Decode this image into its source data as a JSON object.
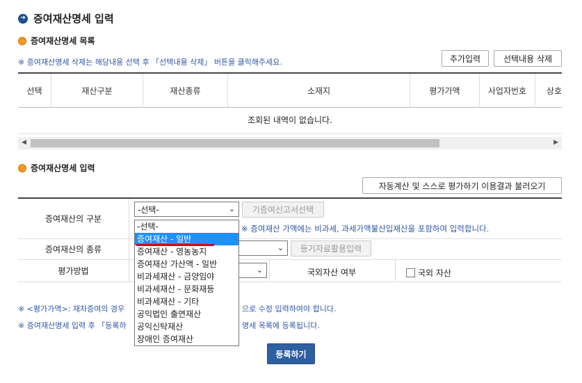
{
  "page": {
    "title": "증여재산명세 입력"
  },
  "list_section": {
    "title": "증여재산명세 목록",
    "notice": "※ 증여재산명세 삭제는 해당내용 선택 후 「선택내용 삭제」 버튼을 클릭해주세요.",
    "add_button": "추가입력",
    "delete_button": "선택내용 삭제",
    "columns": [
      "선택",
      "재산구분",
      "재산종류",
      "소재지",
      "평가가액",
      "사업자번호",
      "상호"
    ],
    "empty_message": "조회된 내역이 없습니다.",
    "scroll_left": "◀",
    "scroll_right": "▶"
  },
  "input_section": {
    "title": "증여재산명세 입력",
    "load_button": "자동계산 및 스스로 평가하기 이용결과 불러오기",
    "category_label": "증여재산의 구분",
    "category_value": "-선택-",
    "prev_report_button": "기증여신고서선택",
    "category_notice": "※ 증여재산 가액에는 비과세, 과세가액불산입재산을 포함하여 입력합니다.",
    "category_options": [
      "-선택-",
      "증여재산 - 일반",
      "증여재산 - 영농농지",
      "증여재산 가산액 - 일반",
      "비과세재산 - 금양임야",
      "비과세재산 - 문화재등",
      "비과세재산 - 기타",
      "공익법인 출연재산",
      "공익신탁재산",
      "장애인 증여재산"
    ],
    "highlighted_option_index": 1,
    "kind_label": "증여재산의 종류",
    "registry_button": "등기자료활용입력",
    "method_label": "평가방법",
    "foreign_label": "국외자산 여부",
    "foreign_checkbox_label": "국외 자산",
    "notice_1_start": "※ <평가가액>: 재차증여의 경우",
    "notice_1_end": "으로 수정 입력하여야 합니다.",
    "notice_2_start": "※ 증여재산명세 입력 후 「등록하",
    "notice_2_end": "명세 목록에 등록됩니다.",
    "register_button": "등록하기"
  },
  "colors": {
    "accent": "#2e5fa0",
    "notice_text": "#2f57a8",
    "highlight": "#1e90ff",
    "annotation": "#d9001b"
  }
}
